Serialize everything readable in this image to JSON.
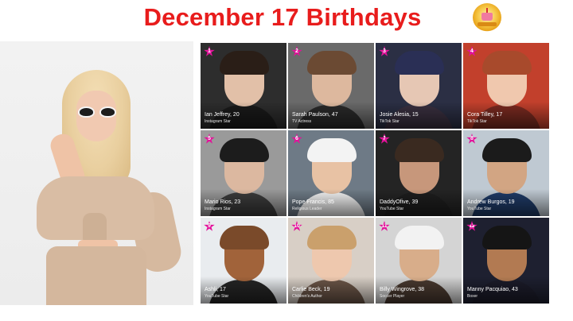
{
  "header": {
    "title": "December 17 Birthdays",
    "logo_icon": "birthday-cake-badge-icon"
  },
  "colors": {
    "title": "#e81c1c",
    "number_badge": "#e3129b"
  },
  "people": [
    {
      "rank": "1",
      "name": "Ian Jeffrey, 20",
      "role": "Instagram Star",
      "bg": "#2d2d2d",
      "skin": "#e2c0a8",
      "hair": "#2a1e17",
      "shirt": "#1a1a1a"
    },
    {
      "rank": "2",
      "name": "Sarah Paulson, 47",
      "role": "TV Actress",
      "bg": "#6a6a6a",
      "skin": "#ddb89e",
      "hair": "#6b4a33",
      "shirt": "#2a2a2a"
    },
    {
      "rank": "3",
      "name": "Josie Alesia, 15",
      "role": "TikTok Star",
      "bg": "#2b2f44",
      "skin": "#e6c7b4",
      "hair": "#2a2f55",
      "shirt": "#3a3040"
    },
    {
      "rank": "4",
      "name": "Cora Tilley, 17",
      "role": "TikTok Star",
      "bg": "#c2402c",
      "skin": "#f0c8ae",
      "hair": "#a84a2c",
      "shirt": "#7a2a20"
    },
    {
      "rank": "5",
      "name": "Mario Rios, 23",
      "role": "Instagram Star",
      "bg": "#9a9a9a",
      "skin": "#dcb8a0",
      "hair": "#1c1c1c",
      "shirt": "#3c3c3c"
    },
    {
      "rank": "6",
      "name": "Pope Francis, 85",
      "role": "Religious Leader",
      "bg": "#6e7a86",
      "skin": "#e8c2a4",
      "hair": "#f3f3f3",
      "shirt": "#f4f4f4"
    },
    {
      "rank": "7",
      "name": "DaddyOfive, 39",
      "role": "YouTube Star",
      "bg": "#242424",
      "skin": "#c7977b",
      "hair": "#3a2a20",
      "shirt": "#1e1e1e"
    },
    {
      "rank": "8",
      "name": "Andrew Burgos, 19",
      "role": "YouTube Star",
      "bg": "#bfc9d2",
      "skin": "#d2a583",
      "hair": "#1b1b1b",
      "shirt": "#1f3b68"
    },
    {
      "rank": "9",
      "name": "Ashli, 17",
      "role": "YouTube Star",
      "bg": "#e9ecef",
      "skin": "#a1633a",
      "hair": "#7a4a2a",
      "shirt": "#252525"
    },
    {
      "rank": "10",
      "name": "Carlie Beck, 19",
      "role": "Children's Author",
      "bg": "#d8cfc6",
      "skin": "#eec8ae",
      "hair": "#caa06c",
      "shirt": "#6c5648"
    },
    {
      "rank": "11",
      "name": "Billy Wingrove, 38",
      "role": "Soccer Player",
      "bg": "#d4d4d4",
      "skin": "#d8ad8a",
      "hair": "#f2f2f2",
      "shirt": "#4a3a30"
    },
    {
      "rank": "12",
      "name": "Manny Pacquiao, 43",
      "role": "Boxer",
      "bg": "#1e2030",
      "skin": "#b27a52",
      "hair": "#151515",
      "shirt": "#1c1c2a"
    }
  ]
}
